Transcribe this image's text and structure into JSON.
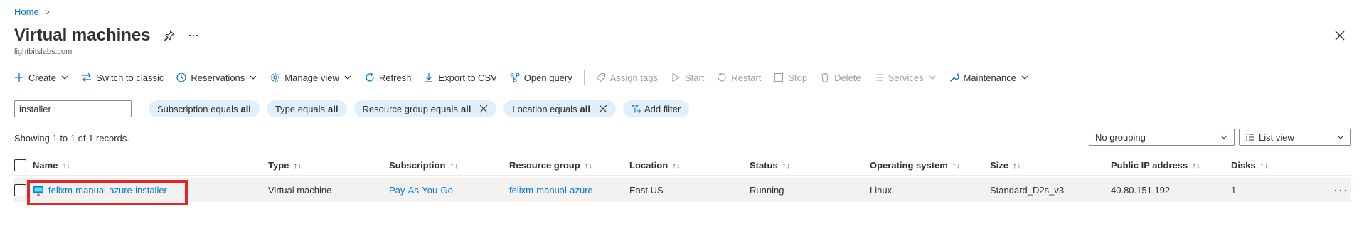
{
  "breadcrumb": {
    "home": "Home",
    "separator": ">"
  },
  "page": {
    "title": "Virtual machines",
    "subtitle": "lightbitslabs.com"
  },
  "toolbar": {
    "create": "Create",
    "switch_classic": "Switch to classic",
    "reservations": "Reservations",
    "manage_view": "Manage view",
    "refresh": "Refresh",
    "export_csv": "Export to CSV",
    "open_query": "Open query",
    "assign_tags": "Assign tags",
    "start": "Start",
    "restart": "Restart",
    "stop": "Stop",
    "delete": "Delete",
    "services": "Services",
    "maintenance": "Maintenance"
  },
  "filters": {
    "search_value": "installer",
    "pills": [
      {
        "label": "Subscription equals",
        "value": "all"
      },
      {
        "label": "Type equals",
        "value": "all"
      },
      {
        "label": "Resource group equals",
        "value": "all"
      },
      {
        "label": "Location equals",
        "value": "all"
      }
    ],
    "add_filter": "Add filter"
  },
  "records_text": "Showing 1 to 1 of 1 records.",
  "grouping": {
    "selected": "No grouping"
  },
  "view": {
    "selected": "List view"
  },
  "table": {
    "columns": [
      "Name",
      "Type",
      "Subscription",
      "Resource group",
      "Location",
      "Status",
      "Operating system",
      "Size",
      "Public IP address",
      "Disks"
    ],
    "sort_glyph": "↑↓",
    "rows": [
      {
        "name": "felixm-manual-azure-installer",
        "type": "Virtual machine",
        "subscription": "Pay-As-You-Go",
        "resource_group": "felixm-manual-azure",
        "location": "East US",
        "status": "Running",
        "os": "Linux",
        "size": "Standard_D2s_v3",
        "public_ip": "40.80.151.192",
        "disks": "1",
        "more": "···"
      }
    ]
  },
  "colors": {
    "accent": "#0078d4",
    "pill_bg": "#e1effa",
    "highlight": "#e3242b",
    "row_bg": "#f3f2f1"
  }
}
